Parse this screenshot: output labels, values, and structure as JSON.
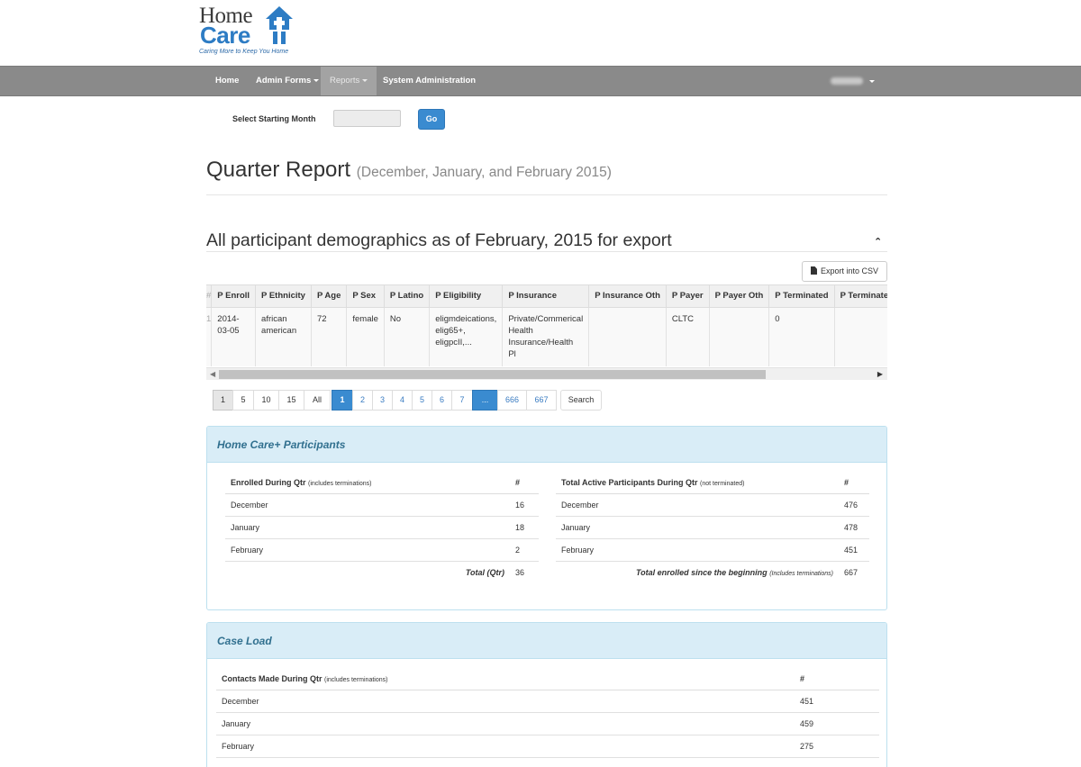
{
  "brand": {
    "line1": "Home",
    "line2": "Care",
    "tagline": "Caring More to Keep You Home",
    "colors": {
      "blue": "#2d7cc4",
      "dark": "#3a3a3a"
    }
  },
  "nav": {
    "items": [
      {
        "label": "Home",
        "dropdown": false
      },
      {
        "label": "Admin Forms",
        "dropdown": true
      },
      {
        "label": "Reports",
        "dropdown": true,
        "active": true
      },
      {
        "label": "System Administration",
        "dropdown": false
      }
    ],
    "user_menu": {
      "dropdown": true
    }
  },
  "month_select": {
    "label": "Select Starting Month",
    "value": "",
    "go_label": "Go"
  },
  "page": {
    "title": "Quarter Report",
    "subtitle": "(December, January, and February 2015)"
  },
  "demographics": {
    "heading": "All participant demographics as of February, 2015 for export",
    "collapse_icon": "chevron-up-icon",
    "export_label": "Export into CSV",
    "export_icon": "file-icon",
    "columns": [
      "#",
      "P Enroll",
      "P Ethnicity",
      "P Age",
      "P Sex",
      "P Latino",
      "P Eligibility",
      "P Insurance",
      "P Insurance Oth",
      "P Payer",
      "P Payer Oth",
      "P Terminated",
      "P Terminated Dat"
    ],
    "rows": [
      [
        "1",
        "2014-03-05",
        "african american",
        "72",
        "female",
        "No",
        "eligmdeications, elig65+, eligpcII,...",
        "Private/Commerical Health Insurance/Health Pl",
        "",
        "CLTC",
        "",
        "0",
        ""
      ]
    ]
  },
  "pagination": {
    "page_sizes": [
      "1",
      "5",
      "10",
      "15",
      "All"
    ],
    "selected_size": "1",
    "pages": [
      "1",
      "2",
      "3",
      "4",
      "5",
      "6",
      "7",
      "...",
      "666",
      "667"
    ],
    "current_page": "1",
    "search_label": "Search"
  },
  "participants_panel": {
    "title": "Home Care+ Participants",
    "enrolled": {
      "header": "Enrolled During Qtr",
      "header_note": "(includes terminations)",
      "count_header": "#",
      "rows": [
        {
          "month": "December",
          "count": "16"
        },
        {
          "month": "January",
          "count": "18"
        },
        {
          "month": "February",
          "count": "2"
        }
      ],
      "total_label": "Total (Qtr)",
      "total": "36"
    },
    "active": {
      "header": "Total Active Participants During Qtr",
      "header_note": "(not terminated)",
      "count_header": "#",
      "rows": [
        {
          "month": "December",
          "count": "476"
        },
        {
          "month": "January",
          "count": "478"
        },
        {
          "month": "February",
          "count": "451"
        }
      ],
      "total_label": "Total enrolled since the beginning",
      "total_note": "(Includes terminations)",
      "total": "667"
    }
  },
  "caseload_panel": {
    "title": "Case Load",
    "contacts": {
      "header": "Contacts Made During Qtr",
      "header_note": "(includes terminations)",
      "count_header": "#",
      "rows": [
        {
          "month": "December",
          "count": "451"
        },
        {
          "month": "January",
          "count": "459"
        },
        {
          "month": "February",
          "count": "275"
        }
      ]
    }
  }
}
